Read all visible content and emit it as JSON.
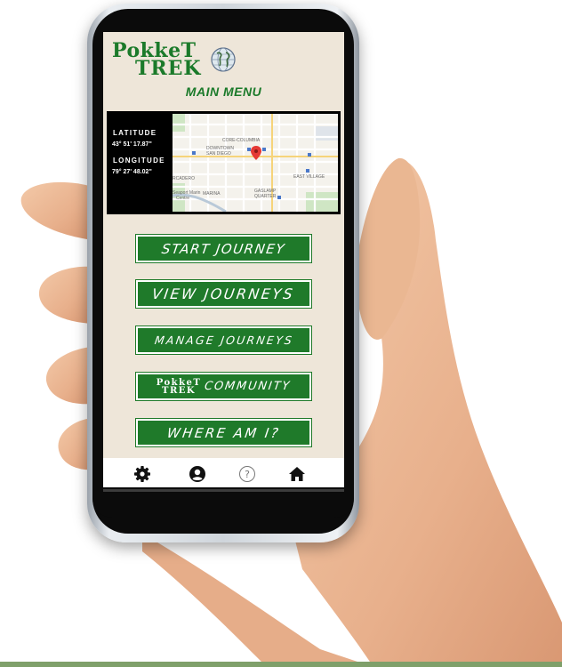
{
  "app": {
    "logo_line1": "PokkeT",
    "logo_line2": "TREK",
    "menu_title": "MAIN MENU"
  },
  "location": {
    "latitude_label": "LATITUDE",
    "latitude_value": "43° 51' 17.87\"",
    "longitude_label": "LONGITUDE",
    "longitude_value": "79° 27' 48.02\""
  },
  "map": {
    "labels": {
      "core_columbia": "CORE-COLUMBIA",
      "downtown_line1": "DOWNTOWN",
      "downtown_line2": "SAN DIEGO",
      "east_village": "EAST VILLAGE",
      "marina": "MARINA",
      "gaslamp_line1": "GASLAMP",
      "gaslamp_line2": "QUARTER",
      "rcadero": "RCADERO",
      "seaport_line1": "Seaport Marin",
      "seaport_line2": "Centre"
    }
  },
  "menu": {
    "start_journey": "START JOURNEY",
    "view_journeys": "VIEW JOURNEYS",
    "manage_journeys": "MANAGE JOURNEYS",
    "community_logo_line1": "PokkeT",
    "community_logo_line2": "TREK",
    "community": "COMMUNITY",
    "where_am_i": "WHERE AM I?"
  },
  "nav": {
    "icons": [
      "gear-icon",
      "user-icon",
      "help-icon",
      "home-icon"
    ]
  },
  "colors": {
    "accent_green": "#1f7a2a",
    "screen_background": "#eee6d9",
    "map_pin": "#e53935"
  }
}
